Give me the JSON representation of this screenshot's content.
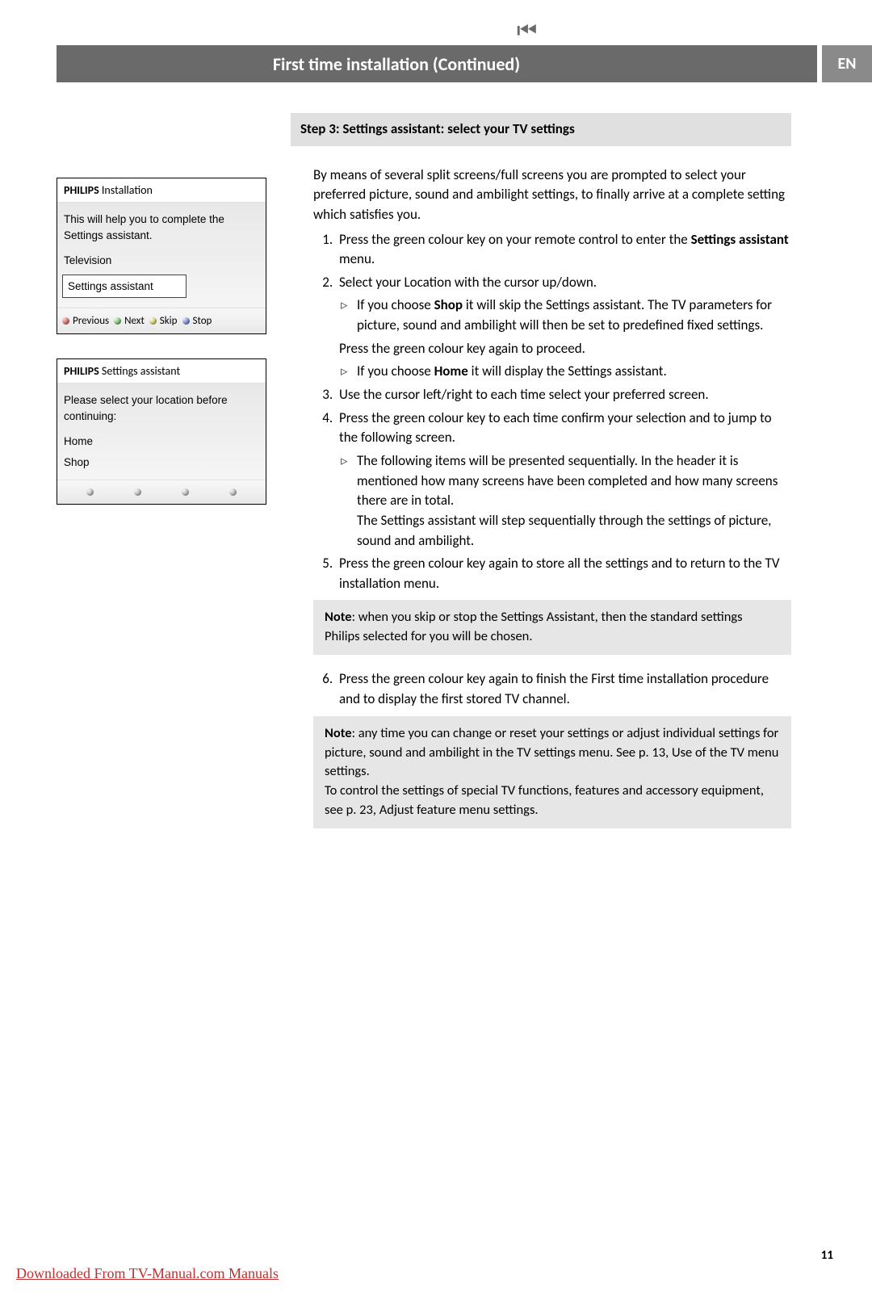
{
  "nav_icon": "⏮",
  "header": {
    "title": "First time installation  (Continued)",
    "lang": "EN"
  },
  "tv_box1": {
    "brand": "PHILIPS ",
    "title": "Installation",
    "intro": "This will help you to complete the Settings assistant.",
    "item1": "Television",
    "selected": "Settings assistant",
    "btn1": "Previous",
    "btn2": "Next",
    "btn3": "Skip",
    "btn4": "Stop"
  },
  "tv_box2": {
    "brand": "PHILIPS ",
    "title": "Settings assistant",
    "intro": "Please select your location before continuing:",
    "opt1": "Home",
    "opt2": "Shop"
  },
  "step_heading": "Step 3: Settings assistant: select your TV settings",
  "intro_para": "By means of several split screens/full screens you are prompted to select your preferred picture, sound and ambilight settings, to finally arrive at a complete setting which satisfies you.",
  "li1a": "Press the green colour key on your remote control to enter the ",
  "li1b": "Settings assistant",
  "li1c": " menu.",
  "li2": "Select your Location with the cursor up/down.",
  "li2s1a": "If you choose ",
  "li2s1b": "Shop",
  "li2s1c": " it will skip the Settings assistant. The TV parameters for picture, sound and ambilight will then be set to predefined fixed settings.",
  "li2p": "Press the green colour key again to proceed.",
  "li2s2a": "If you choose ",
  "li2s2b": "Home",
  "li2s2c": " it will display the Settings assistant.",
  "li3": "Use the cursor left/right to each time select your preferred screen.",
  "li4": "Press the green colour key to each time confirm your selection and to jump to the following screen.",
  "li4s1": "The following items will be presented sequentially. In the header it is mentioned how many screens have been completed and how many screens there are in total.",
  "li4s1b": "The Settings assistant will step sequentially through the settings of picture, sound and ambilight.",
  "li5": "Press the green colour key again to store all the settings and to return to the TV installation menu.",
  "note1a": "Note",
  "note1b": ": when you skip or stop the Settings Assistant, then the standard settings Philips selected for you will be chosen.",
  "li6": "Press the green colour key again to finish the First time installation procedure and to display the first stored TV channel.",
  "note2a": "Note",
  "note2b": ": any time you can change or reset your settings or adjust individual settings for picture, sound and ambilight in the TV settings menu. See p. 13, Use of the TV menu settings.",
  "note2c": "To control the settings of special TV functions, features and accessory equipment, see p. 23,  Adjust feature menu settings.",
  "page_number": "11",
  "footer_link": "Downloaded From TV-Manual.com Manuals"
}
